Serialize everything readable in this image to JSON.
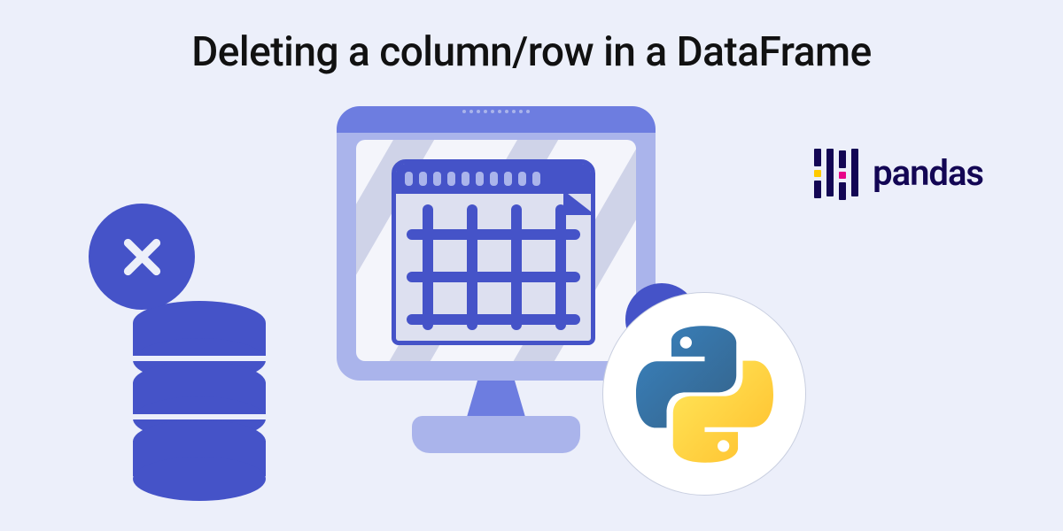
{
  "title": "Deleting a column/row in a DataFrame",
  "pandas": {
    "label": "pandas"
  },
  "icons": {
    "delete": "close-icon",
    "minus": "minus-icon",
    "python": "python-logo",
    "pandas": "pandas-logo"
  }
}
